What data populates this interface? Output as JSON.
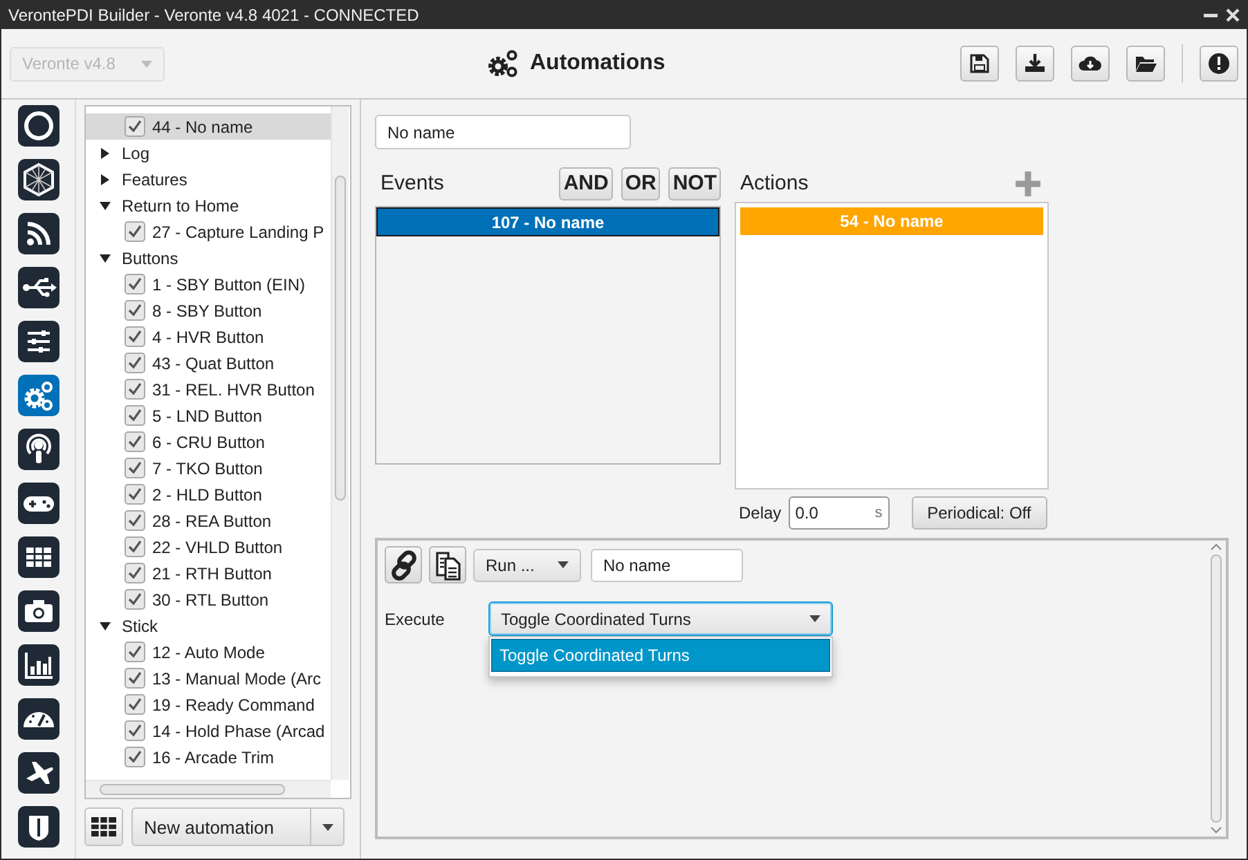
{
  "window": {
    "title": "VerontePDI Builder - Veronte v4.8 4021 - CONNECTED"
  },
  "toolbar": {
    "device_select": {
      "value": "Veronte v4.8",
      "disabled": true
    },
    "title": "Automations",
    "buttons": [
      {
        "kind": "save"
      },
      {
        "kind": "download"
      },
      {
        "kind": "cloud"
      },
      {
        "kind": "folder"
      },
      {
        "kind": "info"
      }
    ]
  },
  "rail": [
    {
      "kind": "ring",
      "selected": false
    },
    {
      "kind": "mesh",
      "selected": false
    },
    {
      "kind": "rss",
      "selected": false
    },
    {
      "kind": "usb",
      "selected": false
    },
    {
      "kind": "sliders",
      "selected": false
    },
    {
      "kind": "gears",
      "selected": true
    },
    {
      "kind": "podcast",
      "selected": false
    },
    {
      "kind": "gamepad",
      "selected": false
    },
    {
      "kind": "grid",
      "selected": false
    },
    {
      "kind": "camera",
      "selected": false
    },
    {
      "kind": "chart",
      "selected": false
    },
    {
      "kind": "gauge",
      "selected": false
    },
    {
      "kind": "plane",
      "selected": false
    },
    {
      "kind": "shield",
      "selected": false
    }
  ],
  "tree": {
    "continued_items": [
      {
        "label": "44 - No name",
        "checked": true,
        "selected": true
      }
    ],
    "items": [
      {
        "label": "Log",
        "expanded": false,
        "selected": false
      },
      {
        "label": "Features",
        "expanded": false,
        "selected": false
      },
      {
        "label": "Return to Home",
        "expanded": true,
        "selected": false,
        "children": [
          {
            "label": "27 - Capture Landing P",
            "checked": true,
            "selected": false
          }
        ]
      },
      {
        "label": "Buttons",
        "expanded": true,
        "selected": false,
        "children": [
          {
            "label": "1 - SBY Button (EIN)",
            "checked": true,
            "selected": false
          },
          {
            "label": "8 - SBY Button",
            "checked": true,
            "selected": false
          },
          {
            "label": "4 - HVR Button",
            "checked": true,
            "selected": false
          },
          {
            "label": "43 - Quat Button",
            "checked": true,
            "selected": false
          },
          {
            "label": "31 - REL. HVR Button",
            "checked": true,
            "selected": false
          },
          {
            "label": "5 - LND Button",
            "checked": true,
            "selected": false
          },
          {
            "label": "6 - CRU Button",
            "checked": true,
            "selected": false
          },
          {
            "label": "7 - TKO Button",
            "checked": true,
            "selected": false
          },
          {
            "label": "2 - HLD Button",
            "checked": true,
            "selected": false
          },
          {
            "label": "28 - REA Button",
            "checked": true,
            "selected": false
          },
          {
            "label": "22 - VHLD Button",
            "checked": true,
            "selected": false
          },
          {
            "label": "21 - RTH Button",
            "checked": true,
            "selected": false
          },
          {
            "label": "30 - RTL Button",
            "checked": true,
            "selected": false
          }
        ]
      },
      {
        "label": "Stick",
        "expanded": true,
        "selected": false,
        "children": [
          {
            "label": "12 - Auto Mode",
            "checked": true,
            "selected": false
          },
          {
            "label": "13 - Manual Mode (Arc",
            "checked": true,
            "selected": false
          },
          {
            "label": "19 - Ready Command",
            "checked": true,
            "selected": false
          },
          {
            "label": "14 - Hold Phase (Arcad",
            "checked": true,
            "selected": false
          },
          {
            "label": "16 - Arcade Trim",
            "checked": true,
            "selected": false
          }
        ]
      }
    ]
  },
  "tree_footer": {
    "new_select": "New automation"
  },
  "automation": {
    "name": "No name",
    "events": {
      "label": "Events",
      "operators": [
        "AND",
        "OR",
        "NOT"
      ],
      "items": [
        {
          "label": "107 - No name",
          "color": "#0070b8"
        }
      ]
    },
    "actions": {
      "label": "Actions",
      "items": [
        {
          "label": "54 - No name",
          "color": "#ffa500"
        }
      ],
      "delay": {
        "label": "Delay",
        "value": "0.0",
        "unit": "s"
      },
      "periodical": "Periodical: Off"
    }
  },
  "action_editor": {
    "type_select": "Run ...",
    "name": "No name",
    "execute_label": "Execute",
    "execute_value": "Toggle Coordinated Turns",
    "execute_open": true,
    "options": [
      {
        "label": "Toggle Coordinated Turns",
        "selected": true
      }
    ]
  }
}
